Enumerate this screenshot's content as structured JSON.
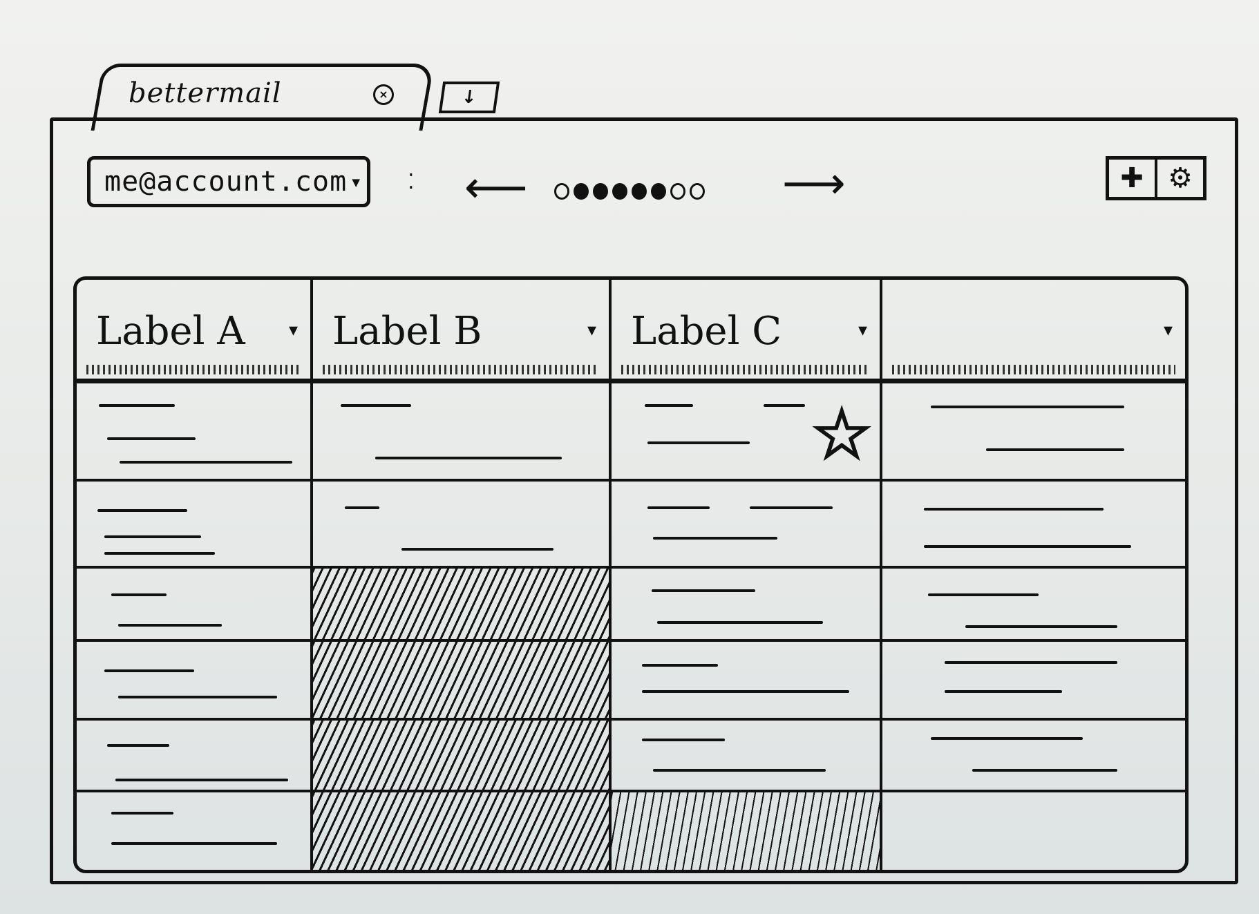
{
  "browser": {
    "tab_title": "bettermail",
    "tab_close_glyph": "×",
    "new_tab_glyph": "↓"
  },
  "toolbar": {
    "account": "me@account.com",
    "account_caret": "▾",
    "drag_handle": "⁚",
    "prev_arrow": "⟵",
    "next_arrow": "⟶",
    "pager_dots": [
      false,
      true,
      true,
      true,
      true,
      true,
      false,
      false
    ],
    "add_glyph": "✚",
    "settings_glyph": "⚙"
  },
  "grid": {
    "columns": [
      {
        "label": "Label A",
        "caret": "▾"
      },
      {
        "label": "Label B",
        "caret": "▾"
      },
      {
        "label": "Label C",
        "caret": "▾"
      },
      {
        "label": "",
        "caret": "▾"
      }
    ]
  },
  "colors": {
    "ink": "#121212",
    "paper": "#eceeec"
  }
}
